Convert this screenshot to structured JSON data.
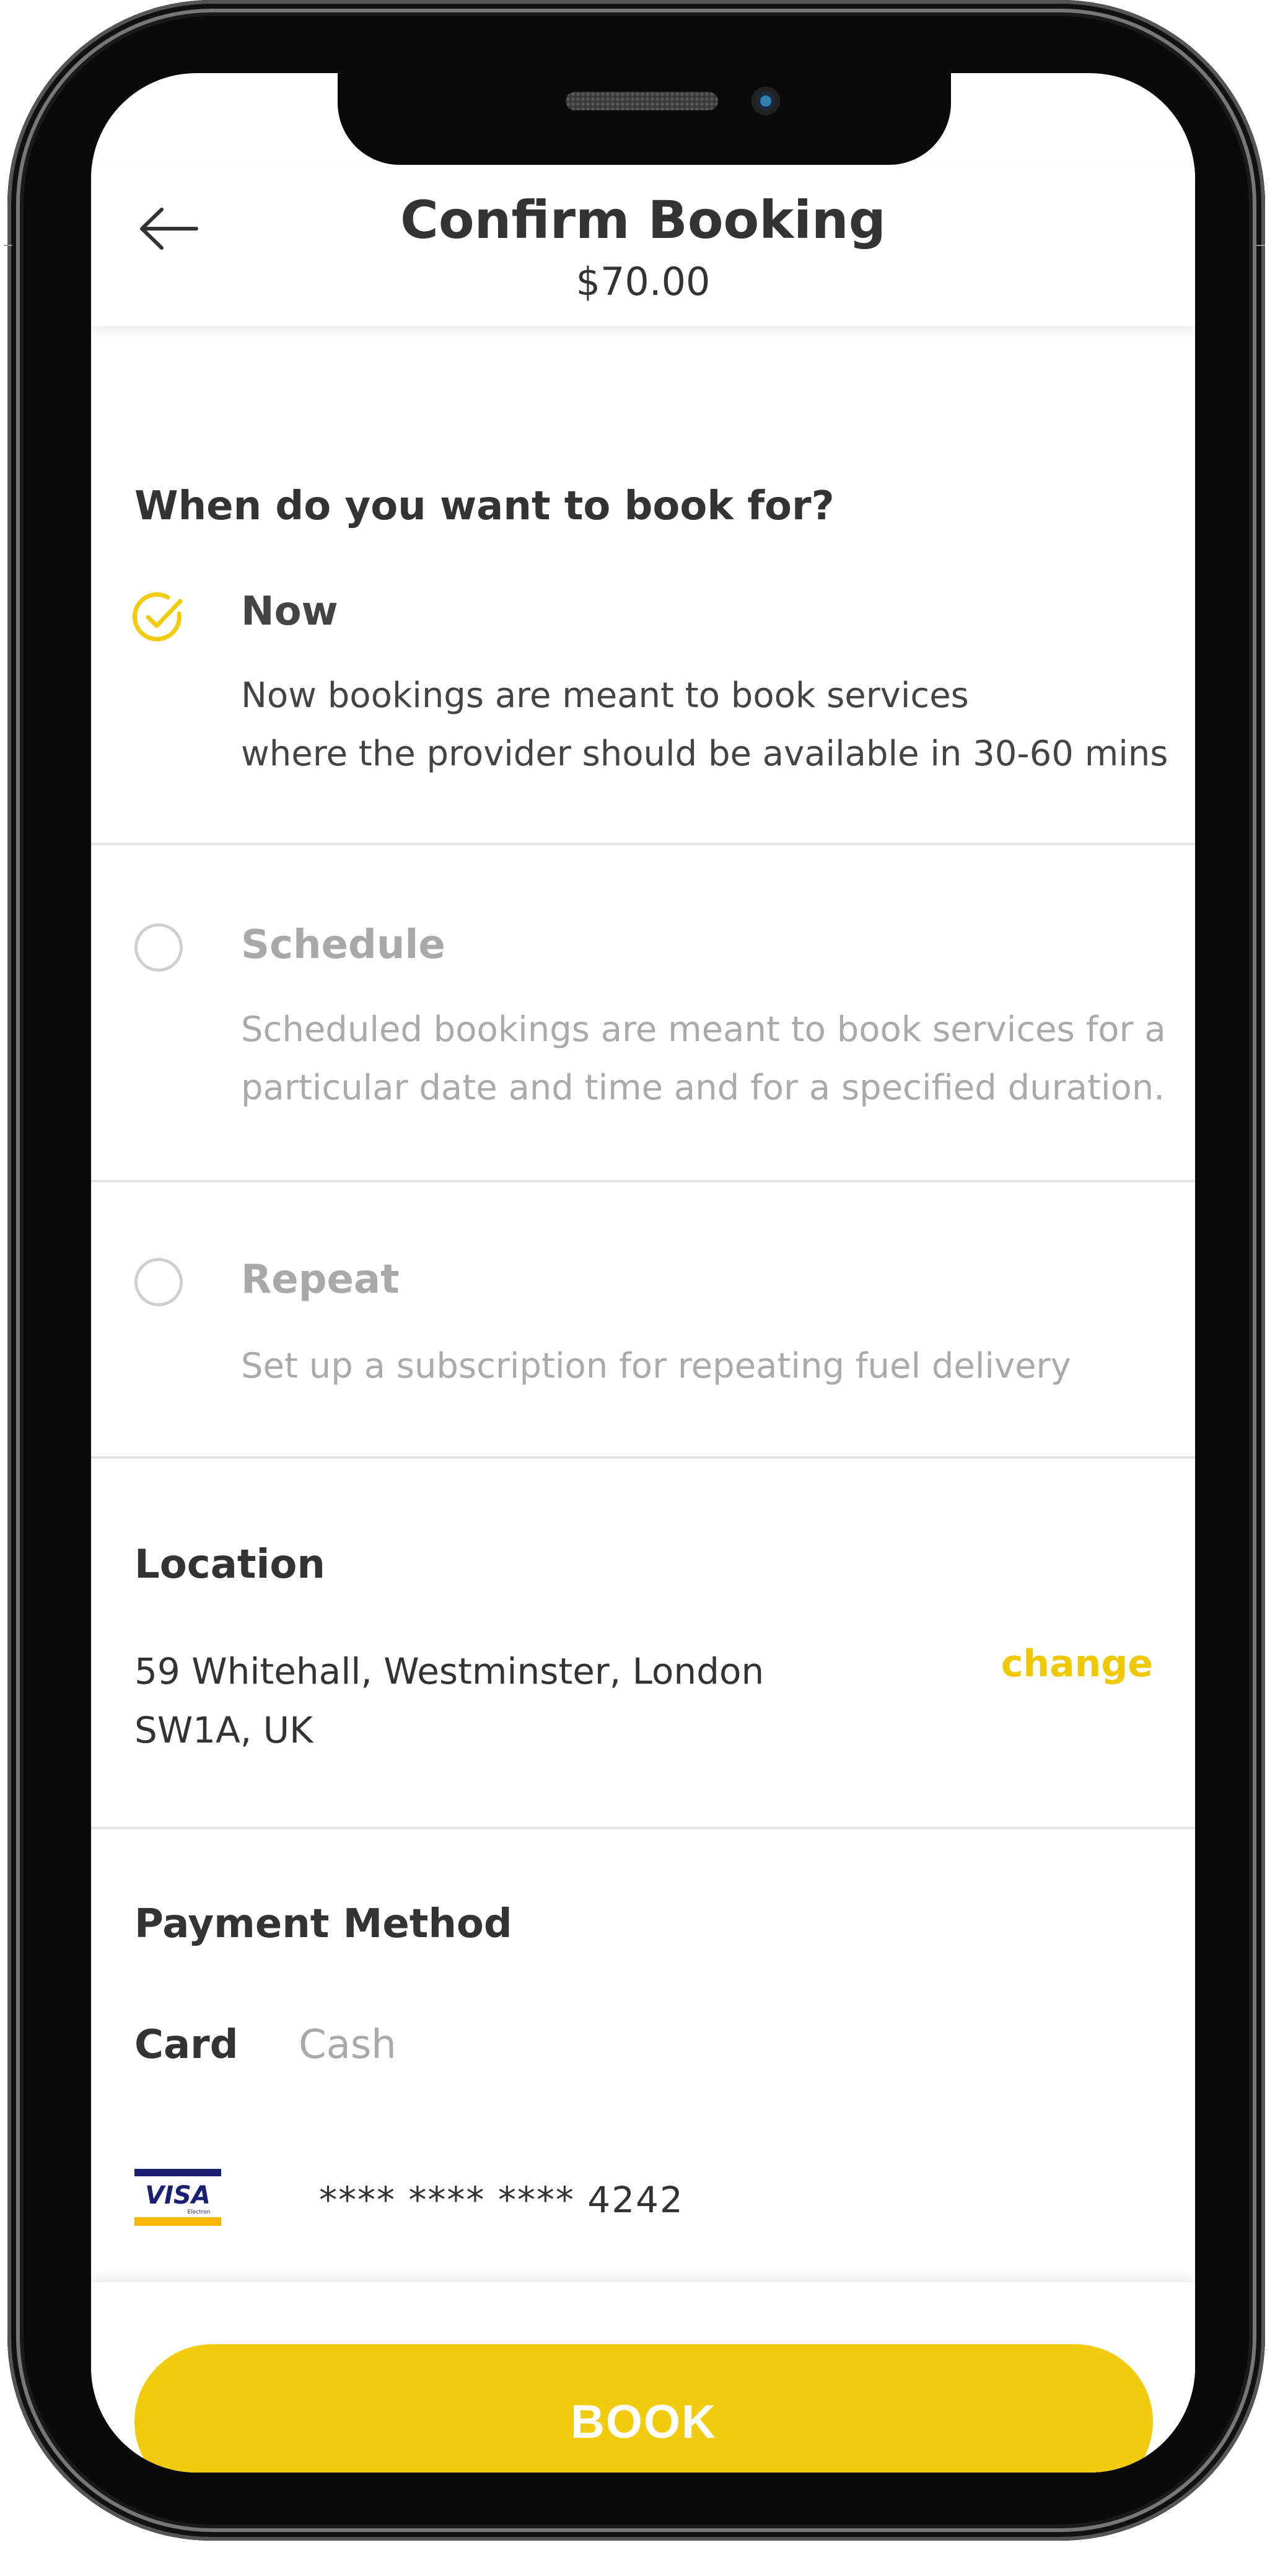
{
  "header": {
    "title": "Confirm Booking",
    "price": "$70.00"
  },
  "booking": {
    "question": "When do you want to book for?",
    "selected": "Now",
    "options": [
      {
        "label": "Now",
        "desc_line1": "Now bookings are meant to book services",
        "desc_line2": "where the provider should be available in 30-60 mins"
      },
      {
        "label": "Schedule",
        "desc_line1": "Scheduled bookings are meant to book services for a",
        "desc_line2": "particular date and time and for a specified duration."
      },
      {
        "label": "Repeat",
        "desc_line1": "Set up a subscription for repeating fuel delivery"
      }
    ]
  },
  "location": {
    "title": "Location",
    "address_line1": "59 Whitehall, Westminster, London",
    "address_line2": "SW1A, UK",
    "change_label": "change"
  },
  "payment": {
    "title": "Payment Method",
    "tabs": [
      "Card",
      "Cash"
    ],
    "selected_tab": "Card",
    "card_brand": "VISA",
    "card_brand_sub": "Electron",
    "card_number": "**** **** **** 4242"
  },
  "actions": {
    "book_label": "BOOK"
  },
  "colors": {
    "accent": "#f2cc0c",
    "accent_text": "#f0c800",
    "text_primary": "#333333",
    "text_muted": "#aaaaaa",
    "visa_blue": "#1a1f71",
    "visa_gold": "#f7b600"
  },
  "icons": {
    "back": "arrow-left-icon",
    "selected_option": "check-circle-icon",
    "unselected_option": "radio-empty-icon",
    "card": "visa-card-icon"
  }
}
